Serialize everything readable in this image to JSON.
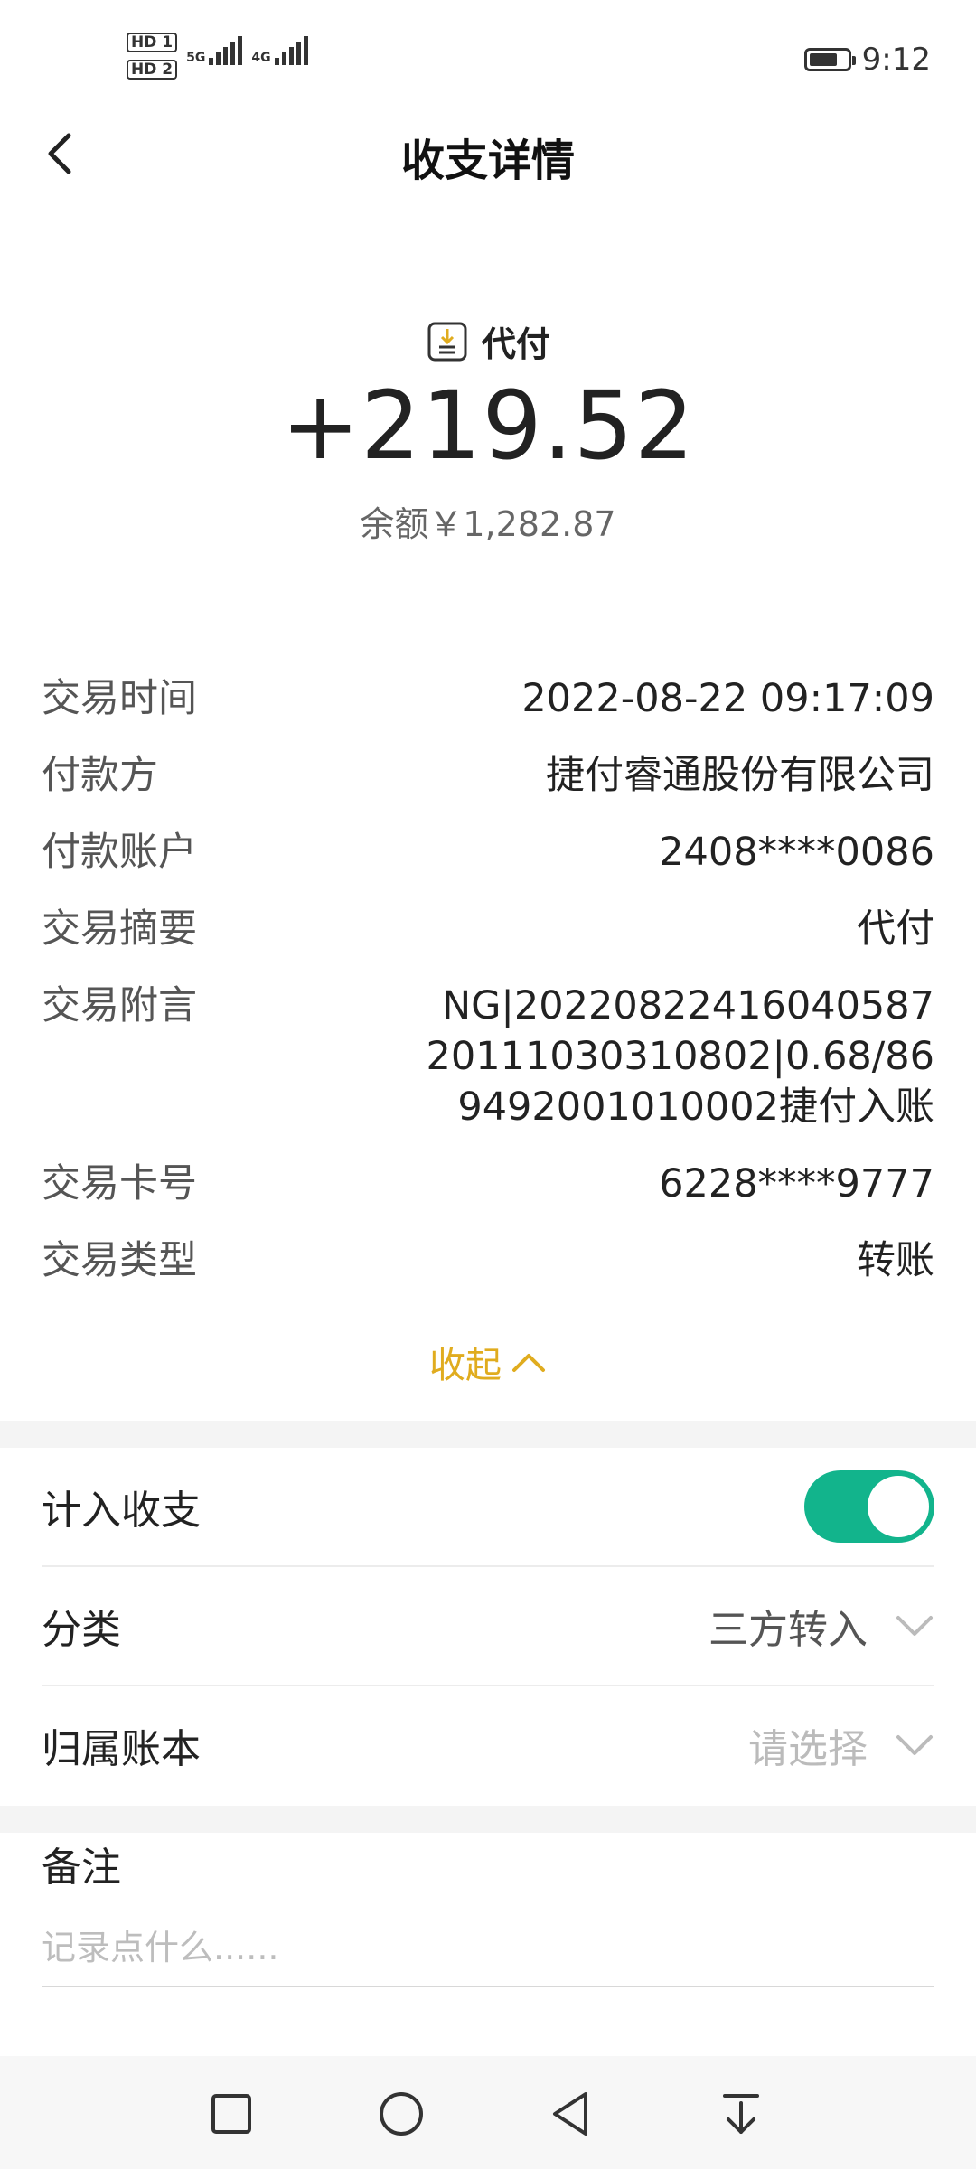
{
  "status_bar": {
    "sim1": "HD 1",
    "sim2": "HD 2",
    "net1": "5G",
    "net2": "4G",
    "time": "9:12",
    "battery_level": 0.75
  },
  "header": {
    "title": "收支详情"
  },
  "summary": {
    "type_label": "代付",
    "amount": "+219.52",
    "balance": "余额￥1,282.87"
  },
  "details": [
    {
      "key": "交易时间",
      "value": "2022-08-22 09:17:09"
    },
    {
      "key": "付款方",
      "value": "捷付睿通股份有限公司"
    },
    {
      "key": "付款账户",
      "value": "2408****0086"
    },
    {
      "key": "交易摘要",
      "value": "代付"
    },
    {
      "key": "交易附言",
      "value": "NG|20220822416040587\n20111030310802|0.68/86\n9492001010002捷付入账"
    },
    {
      "key": "交易卡号",
      "value": "6228****9777"
    },
    {
      "key": "交易类型",
      "value": "转账"
    }
  ],
  "collapse_label": "收起",
  "settings": {
    "include_label": "计入收支",
    "include_on": true,
    "category_label": "分类",
    "category_value": "三方转入",
    "book_label": "归属账本",
    "book_placeholder": "请选择"
  },
  "remark": {
    "label": "备注",
    "placeholder": "记录点什么......"
  },
  "colors": {
    "accent": "#12b48c",
    "collapse": "#e0ac1f"
  }
}
